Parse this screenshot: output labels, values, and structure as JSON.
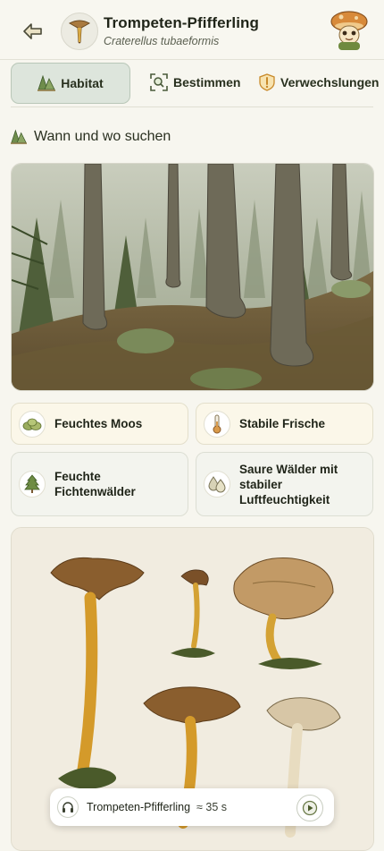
{
  "header": {
    "title": "Trompeten-Pfifferling",
    "subtitle": "Craterellus tubaeformis",
    "back_icon": "back-arrow-icon",
    "avatar_icon": "mushroom-mascot-icon"
  },
  "tabs": [
    {
      "label": "Habitat",
      "icon": "forest-icon",
      "active": true
    },
    {
      "label": "Bestimmen",
      "icon": "scan-icon",
      "active": false
    },
    {
      "label": "Verwechslungen",
      "icon": "warning-icon",
      "active": false
    }
  ],
  "section": {
    "title": "Wann und wo suchen",
    "icon": "forest-icon"
  },
  "habitat_cards": [
    {
      "label": "Feuchtes Moos",
      "icon": "moss-icon"
    },
    {
      "label": "Stabile Frische",
      "icon": "thermometer-icon"
    },
    {
      "label": "Feuchte Fichtenwälder",
      "icon": "spruce-icon"
    },
    {
      "label": "Saure Wälder mit stabiler Luftfeuchtigkeit",
      "icon": "droplets-icon"
    }
  ],
  "audio": {
    "name": "Trompeten-Pfifferling",
    "duration": "≈ 35 s",
    "icon": "headphones-icon",
    "play_icon": "play-icon"
  },
  "colors": {
    "background": "#f7f6ef",
    "active_tab": "#dde5dc",
    "card_cream": "#fbf7e9",
    "accent_green": "#5a7a3a",
    "warning_orange": "#d9942e"
  }
}
